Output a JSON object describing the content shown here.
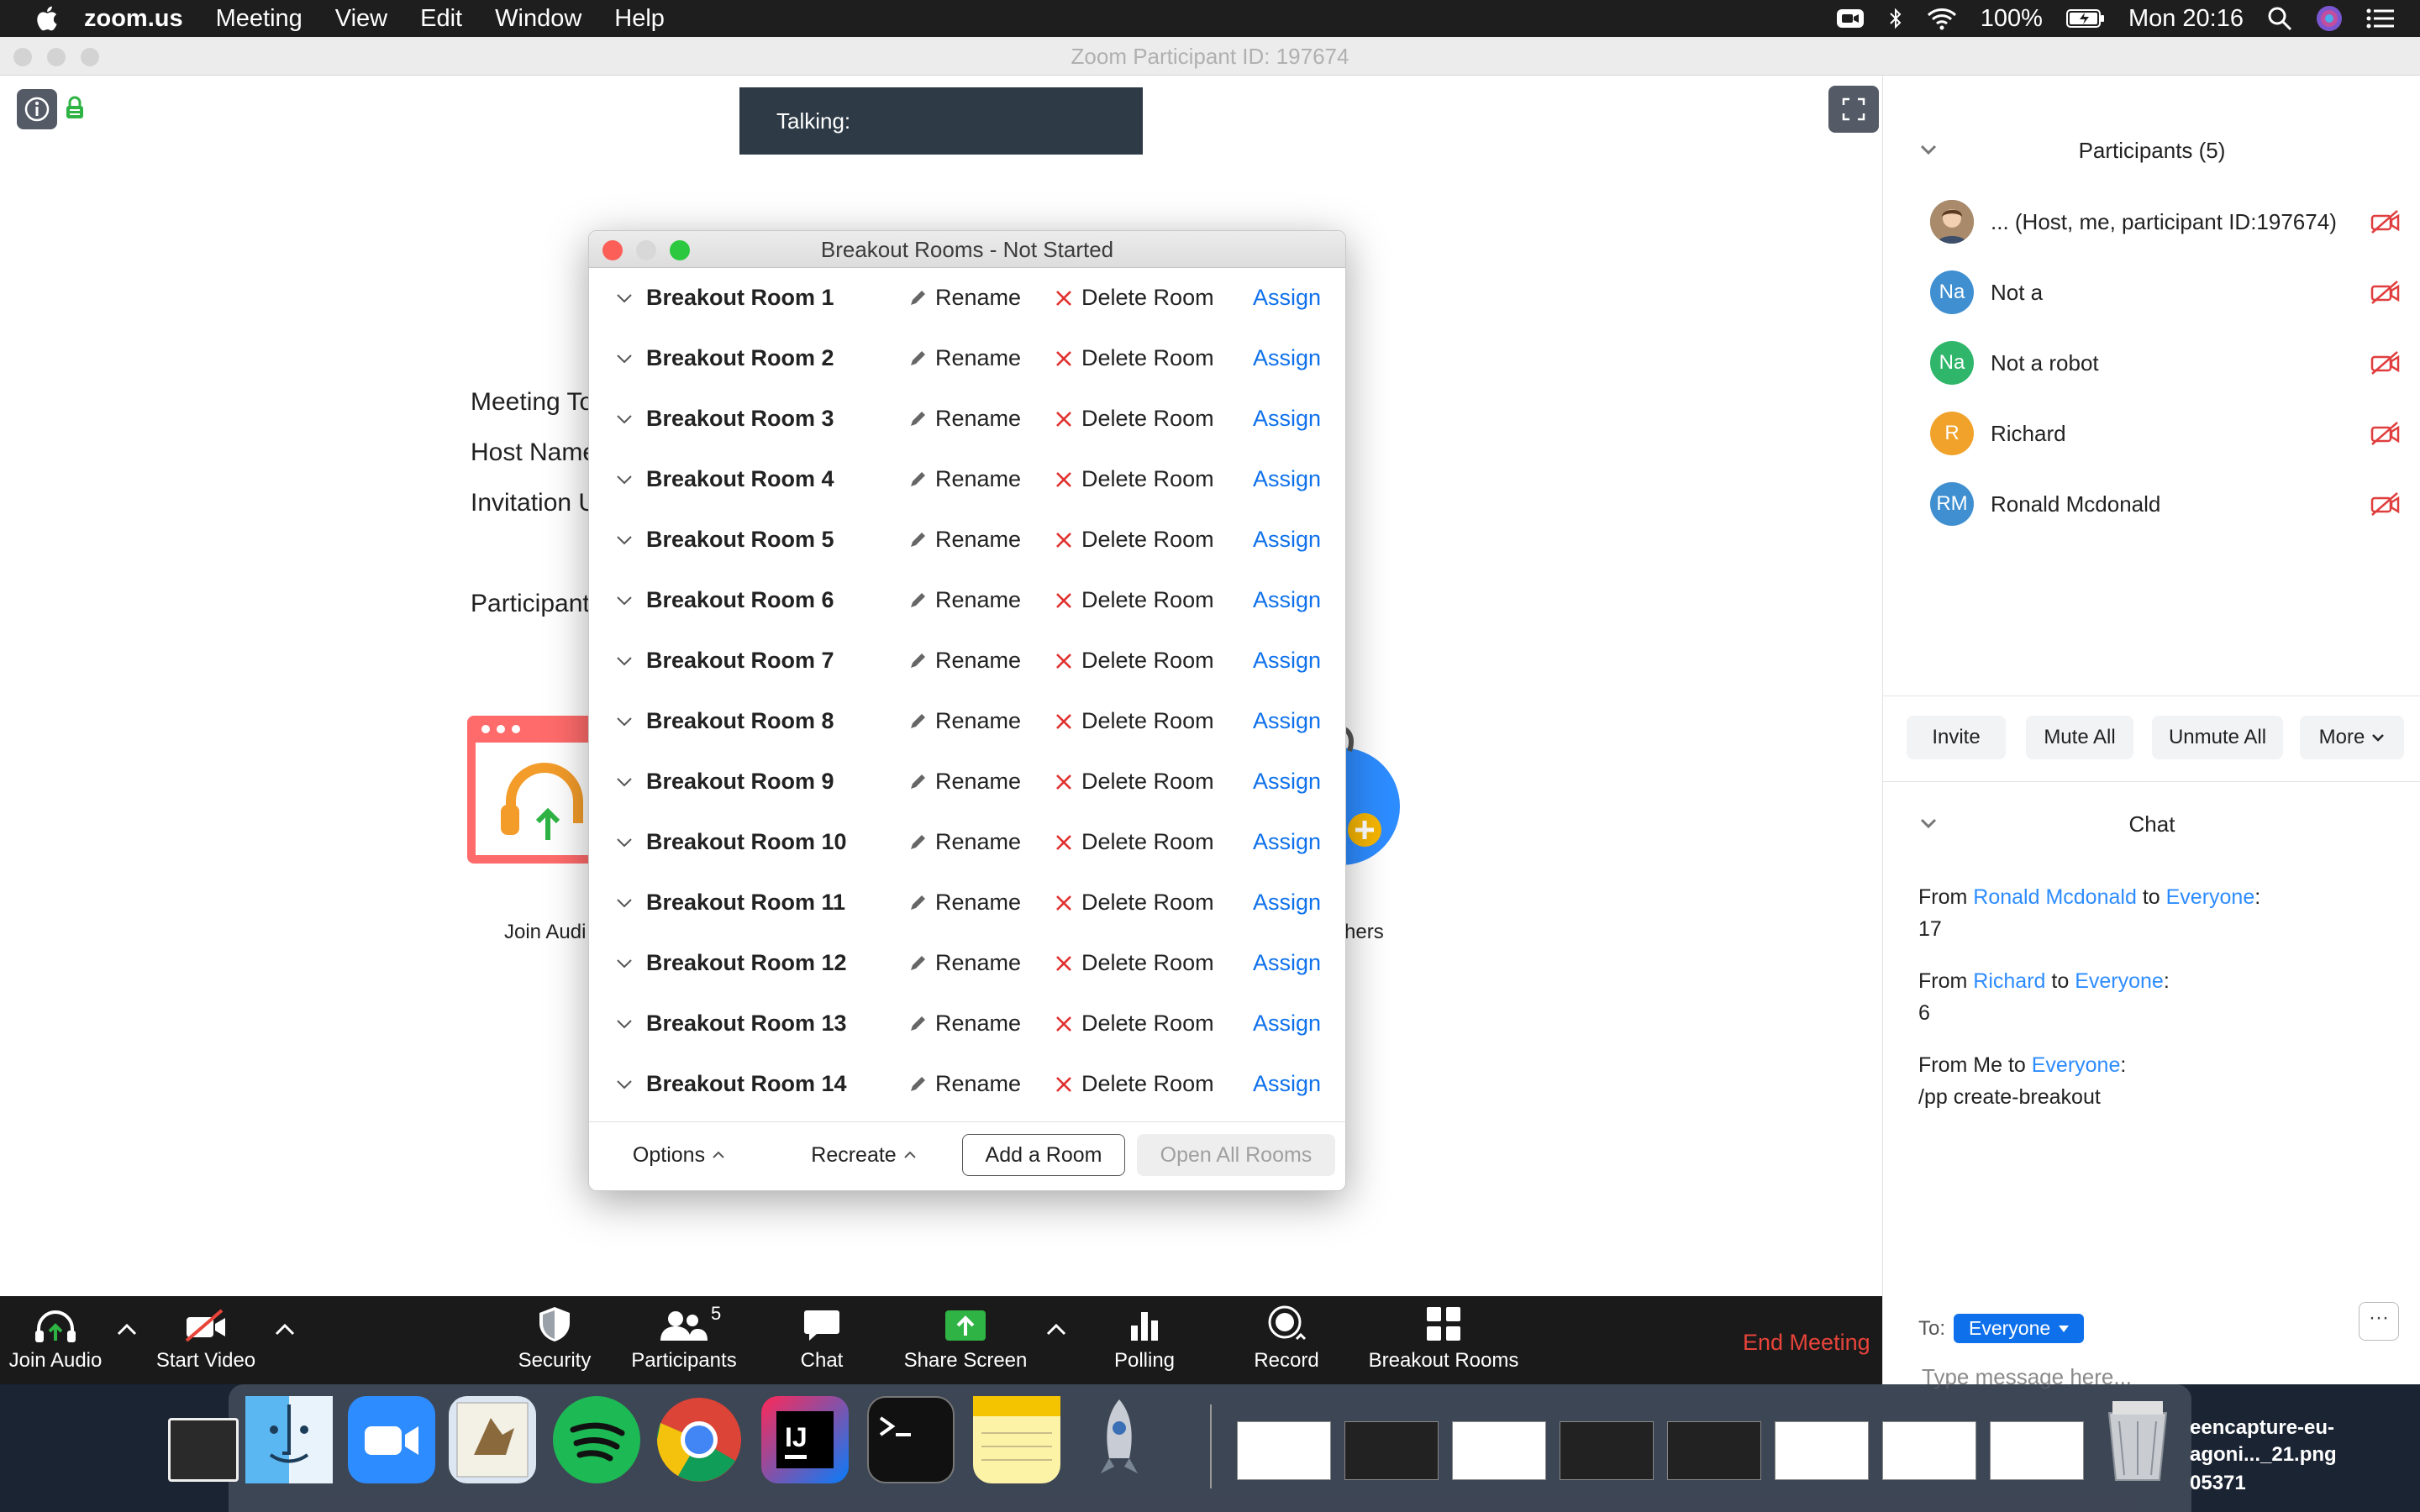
{
  "menubar": {
    "app": "zoom.us",
    "items": [
      "Meeting",
      "View",
      "Edit",
      "Window",
      "Help"
    ],
    "battery": "100%",
    "clock": "Mon 20:16"
  },
  "window": {
    "title": "Zoom Participant ID: 197674"
  },
  "meeting": {
    "talking_label": "Talking:",
    "meta": [
      "Meeting To",
      "Host Name",
      "Invitation U",
      "Participant"
    ],
    "join_audio_label": "Join Audi",
    "others_label": "hers"
  },
  "toolbar": {
    "join_audio": "Join Audio",
    "start_video": "Start Video",
    "security": "Security",
    "participants": "Participants",
    "participants_count": "5",
    "chat": "Chat",
    "share_screen": "Share Screen",
    "polling": "Polling",
    "record": "Record",
    "breakout_rooms": "Breakout Rooms",
    "end_meeting": "End Meeting"
  },
  "participants_panel": {
    "title": "Participants (5)",
    "list": [
      {
        "initials": "",
        "name": "...   (Host, me, participant ID:197674)",
        "color": "#8a6d55"
      },
      {
        "initials": "Na",
        "name": "Not a",
        "color": "#3f8fd1"
      },
      {
        "initials": "Na",
        "name": "Not a robot",
        "color": "#2fb66a"
      },
      {
        "initials": "R",
        "name": "Richard",
        "color": "#f0a22a"
      },
      {
        "initials": "RM",
        "name": "Ronald Mcdonald",
        "color": "#3f8fd1"
      }
    ],
    "buttons": {
      "invite": "Invite",
      "mute_all": "Mute All",
      "unmute_all": "Unmute All",
      "more": "More"
    }
  },
  "chat_panel": {
    "title": "Chat",
    "messages": [
      {
        "from_prefix": "From",
        "from": "Ronald Mcdonald",
        "to_word": "to",
        "to": "Everyone",
        "colon": ":",
        "text": "17"
      },
      {
        "from_prefix": "From",
        "from": "Richard",
        "to_word": "to",
        "to": "Everyone",
        "colon": ":",
        "text": "6"
      },
      {
        "from_prefix": "From Me to",
        "from": "",
        "to_word": "",
        "to": "Everyone",
        "colon": ":",
        "text": "/pp create-breakout"
      }
    ],
    "to_label": "To:",
    "to_value": "Everyone",
    "more_label": "···",
    "placeholder": "Type message here..."
  },
  "breakout_dialog": {
    "title": "Breakout Rooms - Not Started",
    "rename_label": "Rename",
    "delete_label": "Delete Room",
    "assign_label": "Assign",
    "rooms": [
      "Breakout Room 1",
      "Breakout Room 2",
      "Breakout Room 3",
      "Breakout Room 4",
      "Breakout Room 5",
      "Breakout Room 6",
      "Breakout Room 7",
      "Breakout Room 8",
      "Breakout Room 9",
      "Breakout Room 10",
      "Breakout Room 11",
      "Breakout Room 12",
      "Breakout Room 13",
      "Breakout Room 14"
    ],
    "footer": {
      "options": "Options",
      "recreate": "Recreate",
      "add_room": "Add a Room",
      "open_all": "Open All Rooms"
    }
  },
  "desktop": {
    "file_lines": [
      "eencapture-eu-",
      "agoni..._21.png",
      "05371"
    ]
  },
  "colors": {
    "zoom_blue": "#0e71eb",
    "end_red": "#e8443a",
    "toolbar_bg": "#1a1a1a",
    "delete_red": "#e0312f"
  }
}
